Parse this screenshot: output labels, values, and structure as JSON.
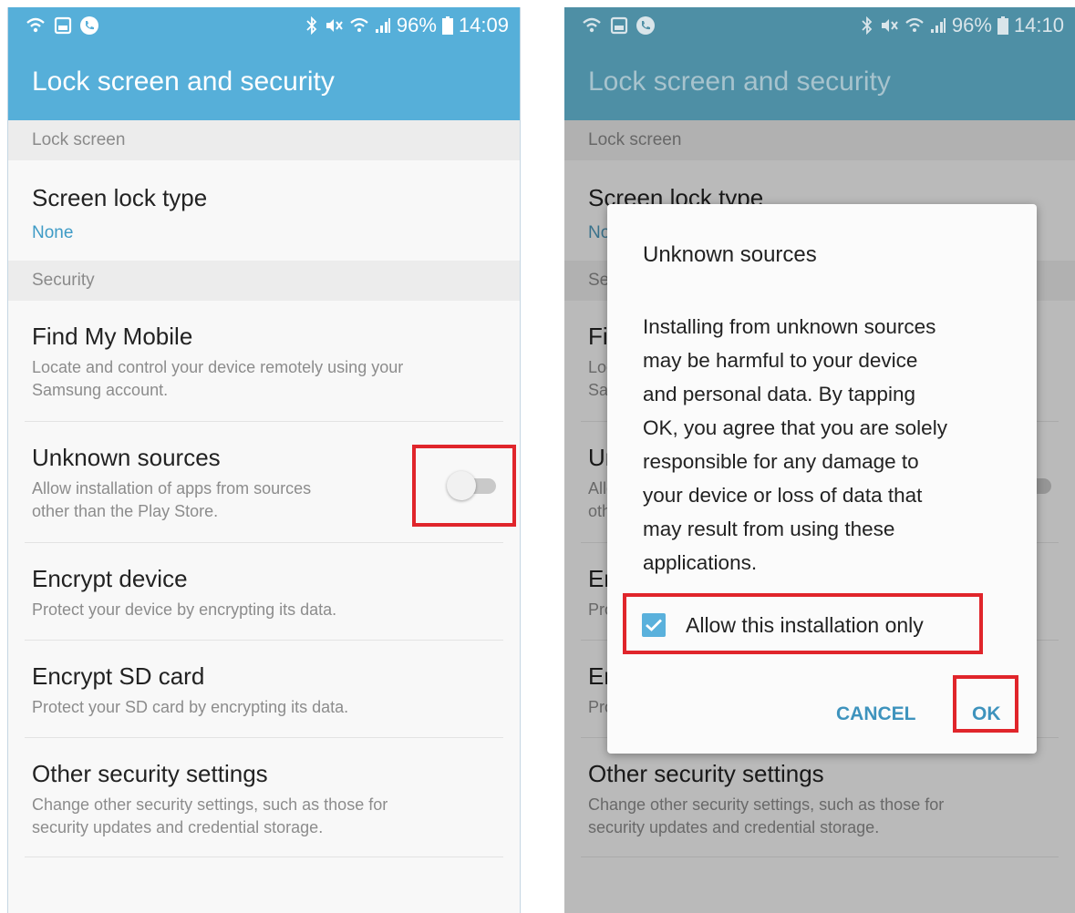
{
  "statusbar_left": {
    "time": "14:09",
    "battery": "96%"
  },
  "statusbar_right": {
    "time": "14:10",
    "battery": "96%"
  },
  "title": "Lock screen and security",
  "sections": {
    "lock_screen": "Lock screen",
    "security": "Security"
  },
  "items": {
    "screen_lock": {
      "title": "Screen lock type",
      "value": "None"
    },
    "find_my_mobile": {
      "title": "Find My Mobile",
      "subtitle_line1": "Locate and control your device remotely using your",
      "subtitle_line2": "Samsung account."
    },
    "unknown_sources": {
      "title": "Unknown sources",
      "subtitle_line1": "Allow installation of apps from sources",
      "subtitle_line2": "other than the Play Store.",
      "enabled": false
    },
    "encrypt_device": {
      "title": "Encrypt device",
      "subtitle": "Protect your device by encrypting its data."
    },
    "encrypt_sd": {
      "title": "Encrypt SD card",
      "subtitle": "Protect your SD card by encrypting its data."
    },
    "other_security": {
      "title": "Other security settings",
      "subtitle_line1": "Change other security settings, such as those for",
      "subtitle_line2": "security updates and credential storage."
    }
  },
  "dialog": {
    "title": "Unknown sources",
    "body_lines": [
      "Installing from unknown sources",
      "may be harmful to your device",
      "and personal data. By tapping",
      "OK, you agree that you are solely",
      "responsible for any damage to",
      "your device or loss of data that",
      "may result from using these",
      "applications."
    ],
    "checkbox_label": "Allow this installation only",
    "checkbox_checked": true,
    "cancel": "CANCEL",
    "ok": "OK"
  },
  "colors": {
    "appbar": "#56afd9",
    "appbar_dimmed": "#4e8fa5",
    "accent": "#3e9bc6",
    "highlight": "#e0252b"
  }
}
